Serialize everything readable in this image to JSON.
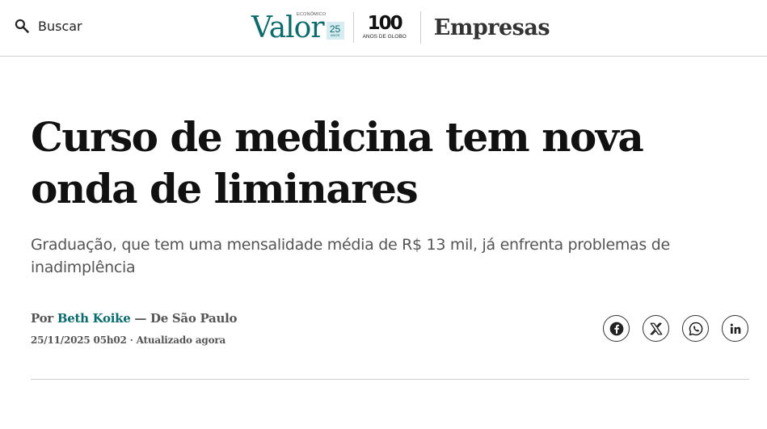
{
  "header": {
    "search_label": "Buscar",
    "brand": {
      "name": "Valor",
      "tag": "ECONÔMICO",
      "anniversary_number": "25",
      "anniversary_label": "ANOS"
    },
    "globo": {
      "number": "100",
      "label": "ANOS DE GLOBO"
    },
    "section": "Empresas"
  },
  "article": {
    "headline": "Curso de medicina tem nova onda de liminares",
    "subheadline": "Graduação, que tem uma mensalidade média de R$ 13 mil, já enfrenta problemas de inadimplência",
    "byline": {
      "prefix": "Por",
      "author": "Beth Koike",
      "location": "— De São Paulo"
    },
    "dateline": "25/11/2025 05h02 · Atualizado agora"
  },
  "share": {
    "icons": [
      "facebook-icon",
      "x-icon",
      "whatsapp-icon",
      "linkedin-icon"
    ]
  },
  "colors": {
    "brand_teal": "#0b6b6d",
    "badge_bg": "#d6ecf0",
    "text": "#111111",
    "muted": "#555555"
  }
}
